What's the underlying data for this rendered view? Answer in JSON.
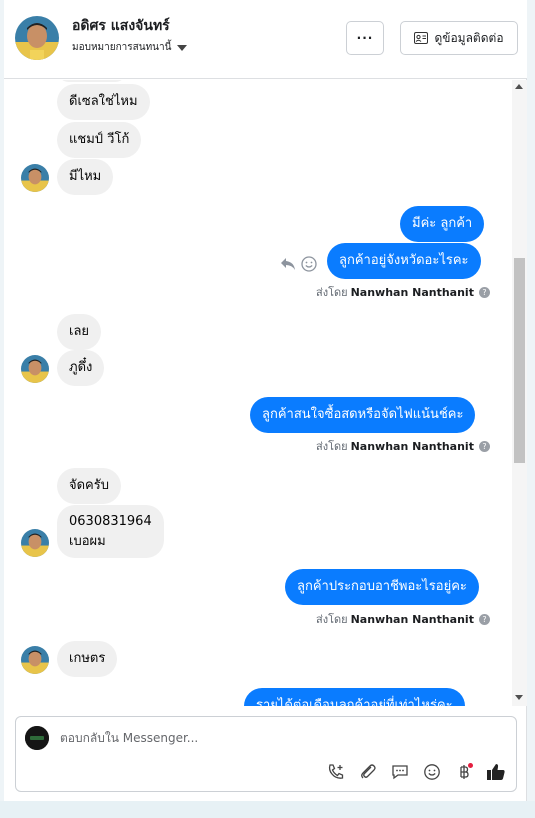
{
  "header": {
    "contact_name": "อดิศร แสงจันทร์",
    "assign_label": "มอบหมายการสนทนานี้",
    "more_label": "···",
    "view_contact_label": "ดูข้อมูลติดต่อ"
  },
  "messages": {
    "m1": "ดีเซลใช่ไหม",
    "m2": "แชมป์ วีโก้",
    "m3": "มีไหม",
    "m4": "มีค่ะ ลูกค้า",
    "m5": "ลูกค้าอยู่จังหวัดอะไรคะ",
    "m6": "เลย",
    "m7": "ภูดึ๋ง",
    "m8": "ลูกค้าสนใจซื้อสดหรือจัดไฟแน้นช์คะ",
    "m9": "จัดครับ",
    "m10_line1": "0630831964",
    "m10_line2": "เบอผม",
    "m11": "ลูกค้าประกอบอาชีพอะไรอยู่คะ",
    "m12": "เกษตร",
    "m13": "รายได้ต่อเดือนลูกค้าอยู่ที่เท่าไหร่คะ"
  },
  "sent_by": {
    "prefix": "ส่งโดย",
    "agent": "Nanwhan Nanthanit"
  },
  "composer": {
    "placeholder": "ตอบกลับใน Messenger..."
  },
  "colors": {
    "outgoing_bubble": "#0a7cff",
    "incoming_bubble": "#f0f0f0"
  }
}
